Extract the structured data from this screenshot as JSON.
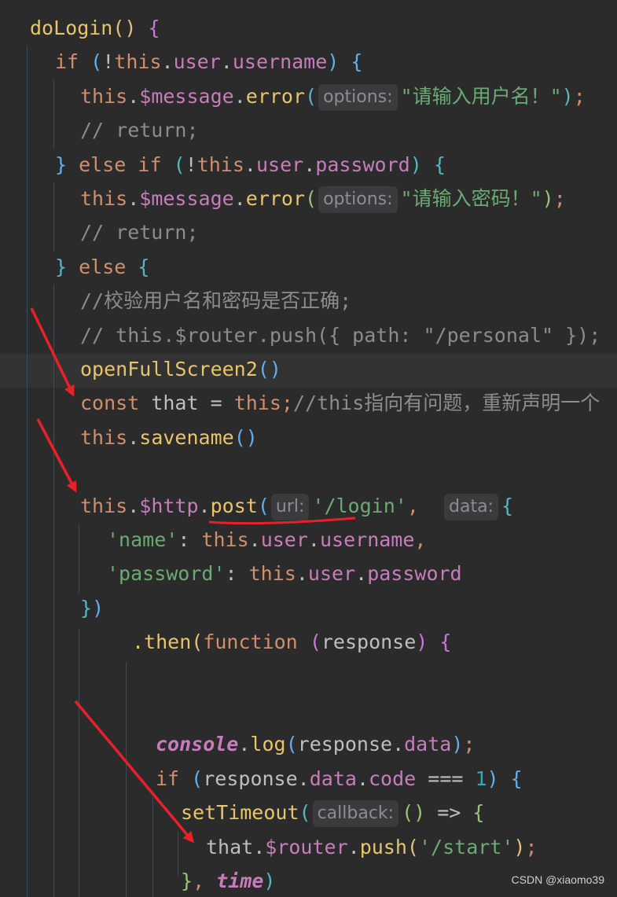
{
  "code": {
    "lines": [
      [
        [
          "doLogin",
          "fn"
        ],
        [
          "()",
          "b1"
        ],
        [
          " ",
          ""
        ],
        [
          "{",
          "b2"
        ]
      ],
      [
        [
          "if",
          "k"
        ],
        [
          " ",
          ""
        ],
        [
          "(",
          "b3"
        ],
        [
          "!",
          "id"
        ],
        [
          "this",
          "k"
        ],
        [
          ".",
          "id"
        ],
        [
          "user",
          "pr"
        ],
        [
          ".",
          "id"
        ],
        [
          "username",
          "pr"
        ],
        [
          ")",
          "b3"
        ],
        [
          " ",
          ""
        ],
        [
          "{",
          "b3"
        ]
      ],
      [
        [
          "this",
          "k"
        ],
        [
          ".",
          "id"
        ],
        [
          "$message",
          "pr"
        ],
        [
          ".",
          "id"
        ],
        [
          "error",
          "fn"
        ],
        [
          "(",
          "b4"
        ],
        [
          "hint:options:",
          ""
        ],
        [
          "\"请输入用户名！\"",
          "sg"
        ],
        [
          ")",
          "b4"
        ],
        [
          ";",
          "k"
        ]
      ],
      [
        [
          "// return;",
          "cm"
        ]
      ],
      [
        [
          "}",
          "b3"
        ],
        [
          " ",
          ""
        ],
        [
          "else",
          "k"
        ],
        [
          " ",
          ""
        ],
        [
          "if",
          "k"
        ],
        [
          " ",
          ""
        ],
        [
          "(",
          "b4"
        ],
        [
          "!",
          "id"
        ],
        [
          "this",
          "k"
        ],
        [
          ".",
          "id"
        ],
        [
          "user",
          "pr"
        ],
        [
          ".",
          "id"
        ],
        [
          "password",
          "pr"
        ],
        [
          ")",
          "b4"
        ],
        [
          " ",
          ""
        ],
        [
          "{",
          "b4"
        ]
      ],
      [
        [
          "this",
          "k"
        ],
        [
          ".",
          "id"
        ],
        [
          "$message",
          "pr"
        ],
        [
          ".",
          "id"
        ],
        [
          "error",
          "fn"
        ],
        [
          "(",
          "b5"
        ],
        [
          "hint:options:",
          ""
        ],
        [
          "\"请输入密码！\"",
          "sg"
        ],
        [
          ")",
          "b5"
        ],
        [
          ";",
          "k"
        ]
      ],
      [
        [
          "// return;",
          "cm"
        ]
      ],
      [
        [
          "}",
          "b4"
        ],
        [
          " ",
          ""
        ],
        [
          "else",
          "k"
        ],
        [
          " ",
          ""
        ],
        [
          "{",
          "b4"
        ]
      ],
      [
        [
          "//校验用户名和密码是否正确;",
          "cm"
        ]
      ],
      [
        [
          "// this.$router.push({ path: \"/personal\" });",
          "cm"
        ]
      ],
      [
        [
          "openFullScreen2",
          "fn"
        ],
        [
          "()",
          "b3"
        ]
      ],
      [
        [
          "const",
          "k"
        ],
        [
          " that = ",
          "id"
        ],
        [
          "this",
          "k"
        ],
        [
          ";",
          "k"
        ],
        [
          "//this指向有问题，重新声明一个",
          "cm"
        ]
      ],
      [
        [
          "this",
          "k"
        ],
        [
          ".",
          "id"
        ],
        [
          "savename",
          "fn"
        ],
        [
          "()",
          "b3"
        ]
      ],
      [],
      [
        [
          "this",
          "k"
        ],
        [
          ".",
          "id"
        ],
        [
          "$http",
          "pr"
        ],
        [
          ".",
          "id"
        ],
        [
          "post",
          "fn"
        ],
        [
          "(",
          "b3"
        ],
        [
          "hint:url:",
          ""
        ],
        [
          "'/login'",
          "sg"
        ],
        [
          ",",
          "k"
        ],
        [
          "  ",
          ""
        ],
        [
          "hint:data:",
          ""
        ],
        [
          "{",
          "b4"
        ]
      ],
      [
        [
          "'name'",
          "sg"
        ],
        [
          ": ",
          "id"
        ],
        [
          "this",
          "k"
        ],
        [
          ".",
          "id"
        ],
        [
          "user",
          "pr"
        ],
        [
          ".",
          "id"
        ],
        [
          "username",
          "pr"
        ],
        [
          ",",
          "k"
        ]
      ],
      [
        [
          "'password'",
          "sg"
        ],
        [
          ": ",
          "id"
        ],
        [
          "this",
          "k"
        ],
        [
          ".",
          "id"
        ],
        [
          "user",
          "pr"
        ],
        [
          ".",
          "id"
        ],
        [
          "password",
          "pr"
        ]
      ],
      [
        [
          "}",
          "b4"
        ],
        [
          ")",
          "b3"
        ]
      ],
      [
        [
          ".then",
          "fn"
        ],
        [
          "(",
          "b1"
        ],
        [
          "function",
          "k"
        ],
        [
          " ",
          ""
        ],
        [
          "(",
          "b2"
        ],
        [
          "response",
          "id"
        ],
        [
          ")",
          "b2"
        ],
        [
          " ",
          ""
        ],
        [
          "{",
          "b2"
        ]
      ],
      [],
      [],
      [
        [
          "console",
          "it"
        ],
        [
          ".",
          "id"
        ],
        [
          "log",
          "fn"
        ],
        [
          "(",
          "b3"
        ],
        [
          "response",
          "id"
        ],
        [
          ".",
          "id"
        ],
        [
          "data",
          "pr"
        ],
        [
          ")",
          "b3"
        ],
        [
          ";",
          "k"
        ]
      ],
      [
        [
          "if",
          "k"
        ],
        [
          " ",
          ""
        ],
        [
          "(",
          "b3"
        ],
        [
          "response",
          "id"
        ],
        [
          ".",
          "id"
        ],
        [
          "data",
          "pr"
        ],
        [
          ".",
          "id"
        ],
        [
          "code",
          "pr"
        ],
        [
          " === ",
          "id"
        ],
        [
          "1",
          "nm"
        ],
        [
          ")",
          "b3"
        ],
        [
          " ",
          ""
        ],
        [
          "{",
          "b3"
        ]
      ],
      [
        [
          "setTimeout",
          "fn"
        ],
        [
          "(",
          "b4"
        ],
        [
          "hint:callback:",
          ""
        ],
        [
          "()",
          "b5"
        ],
        [
          " => ",
          "id"
        ],
        [
          "{",
          "b5"
        ]
      ],
      [
        [
          "that",
          "id"
        ],
        [
          ".",
          "id"
        ],
        [
          "$router",
          "pr"
        ],
        [
          ".",
          "id"
        ],
        [
          "push",
          "fn"
        ],
        [
          "(",
          "b1"
        ],
        [
          "'/start'",
          "sg"
        ],
        [
          ")",
          "b1"
        ],
        [
          ";",
          "k"
        ]
      ],
      [
        [
          "}",
          "b5"
        ],
        [
          ",",
          "k"
        ],
        [
          " ",
          ""
        ],
        [
          "time",
          "it"
        ],
        [
          ")",
          "b4"
        ]
      ]
    ]
  },
  "watermark": "CSDN @xiaomo39"
}
